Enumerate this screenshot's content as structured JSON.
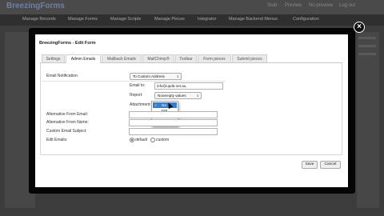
{
  "background": {
    "logo": "BreezingForms",
    "utility_links": [
      "Stub",
      "Preview",
      "No preview",
      "Log out"
    ],
    "nav_items": [
      "Manage Records",
      "Manage Forms",
      "Manage Scripts",
      "Manage Pieces",
      "Integrator",
      "Manage Backend Menus",
      "Configuration"
    ]
  },
  "modal": {
    "title": "BreezingForms - Edit Form",
    "close_glyph": "×",
    "tabs": [
      "Settings",
      "Admin Emails",
      "Mailback Emails",
      "MailChimp®",
      "Toolbar",
      "Form pieces",
      "Submit pieces"
    ],
    "active_tab": "Admin Emails",
    "form": {
      "email_notification_label": "Email Notification:",
      "email_notification_value": "To Custom Address",
      "email_to_label": "Email to:",
      "email_to_value": "info@upd5.net.au,",
      "report_label": "Report:",
      "report_value": "Nonempty values",
      "attachment_label": "Attachment:",
      "attachment_value": "No",
      "attachment_options": [
        "XML",
        "CSV",
        "PDF"
      ],
      "alt_from_email_label": "Alternative From Email:",
      "alt_from_name_label": "Alternative From Name:",
      "custom_subject_label": "Custom Email Subject:",
      "edit_emails_label": "Edit Emails:",
      "edit_emails_options": [
        "default",
        "custom"
      ],
      "edit_emails_selected": "default"
    },
    "buttons": {
      "save": "Save",
      "cancel": "Cancel"
    }
  },
  "colors": {
    "accent": "#3a7bd5",
    "overlay_border": "#050505"
  }
}
